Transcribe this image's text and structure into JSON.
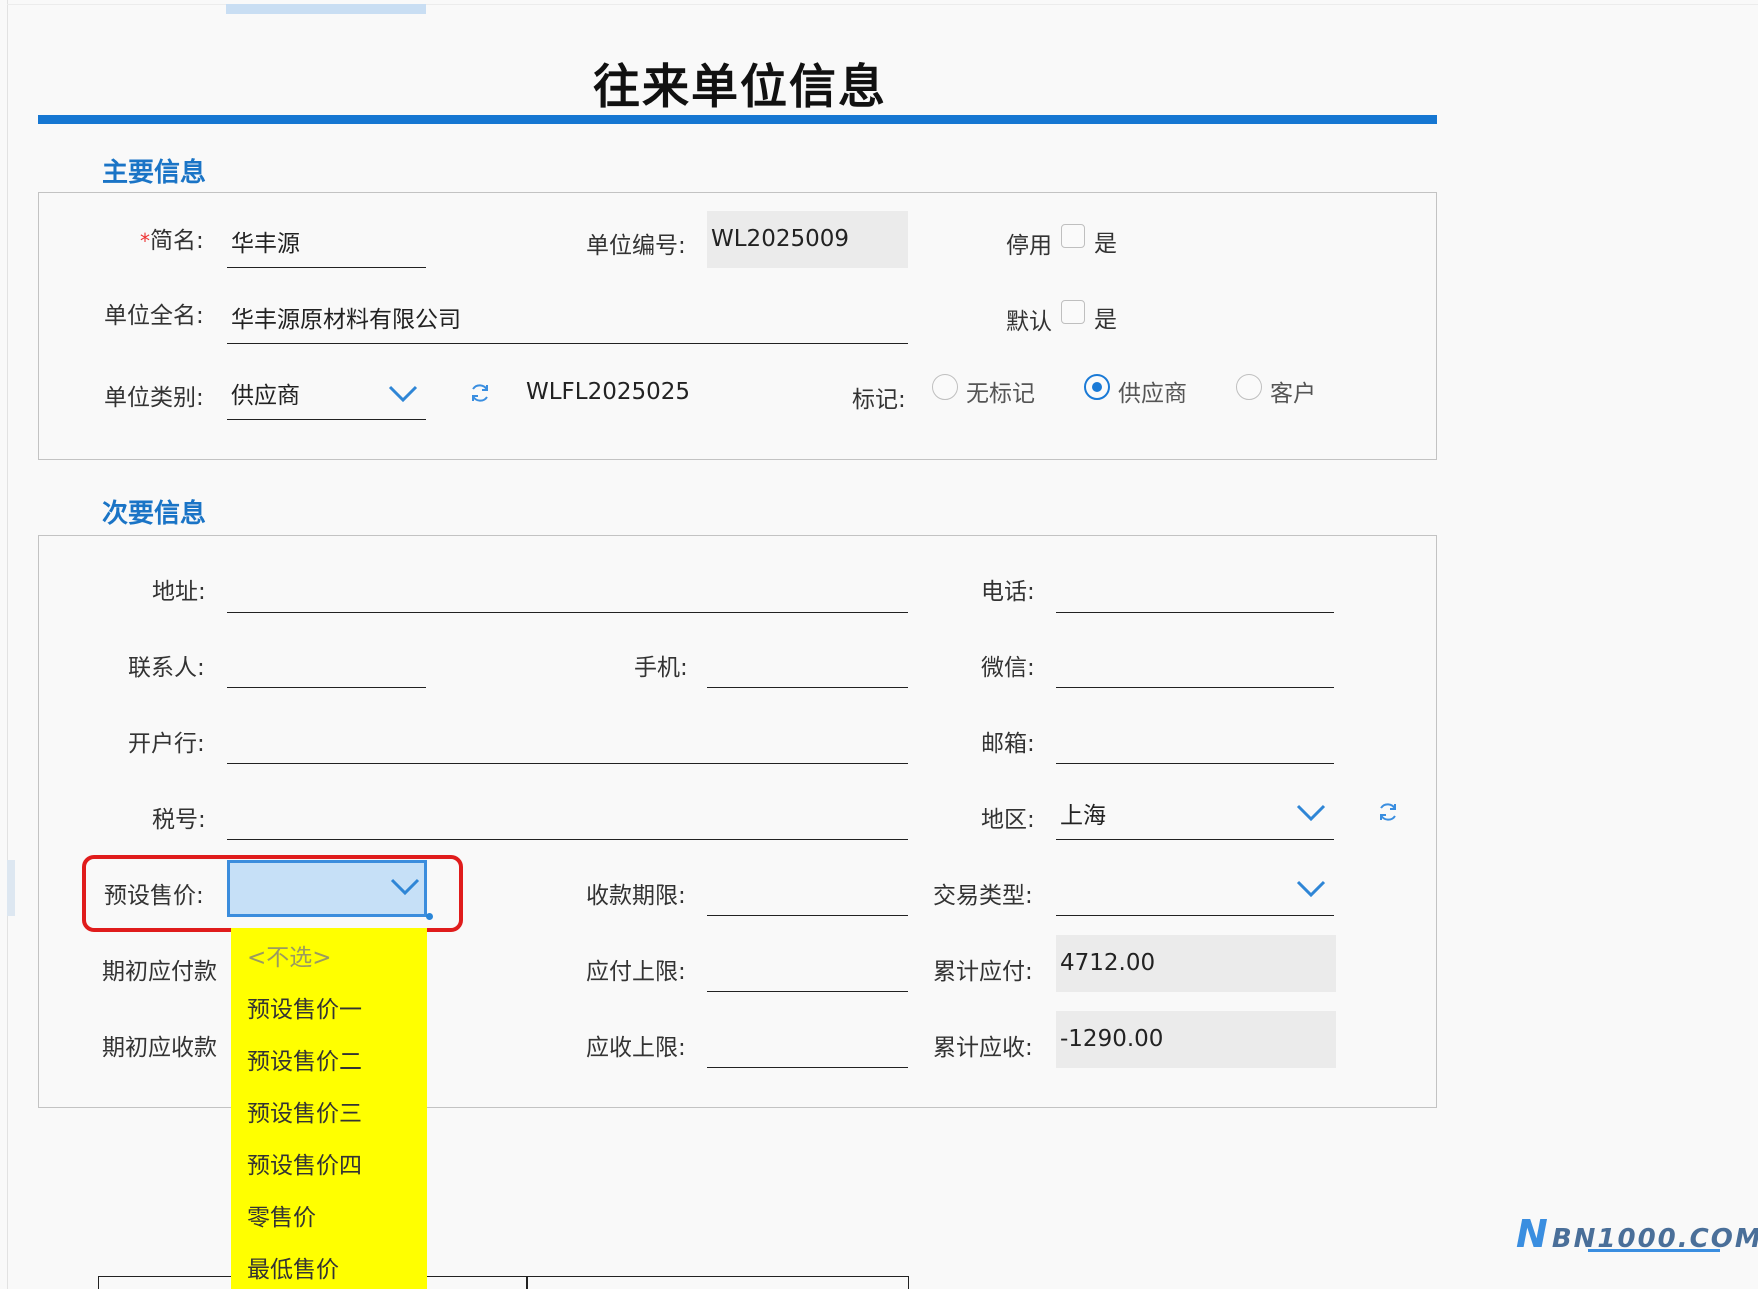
{
  "title": "往来单位信息",
  "primary": {
    "section_title": "主要信息",
    "short_name": {
      "required_mark": "*",
      "label": "简名:",
      "value": "华丰源"
    },
    "code": {
      "label": "单位编号:",
      "value": "WL2025009"
    },
    "disabled": {
      "label": "停用",
      "option": "是",
      "checked": false
    },
    "full_name": {
      "label": "单位全名:",
      "value": "华丰源原材料有限公司"
    },
    "default": {
      "label": "默认",
      "option": "是",
      "checked": false
    },
    "category": {
      "label": "单位类别:",
      "value": "供应商",
      "code": "WLFL2025025"
    },
    "mark": {
      "label": "标记:",
      "options": [
        "无标记",
        "供应商",
        "客户"
      ],
      "selected": "供应商"
    }
  },
  "secondary": {
    "section_title": "次要信息",
    "address": {
      "label": "地址:",
      "value": ""
    },
    "phone": {
      "label": "电话:",
      "value": ""
    },
    "contact": {
      "label": "联系人:",
      "value": ""
    },
    "mobile": {
      "label": "手机:",
      "value": ""
    },
    "wechat": {
      "label": "微信:",
      "value": ""
    },
    "bank": {
      "label": "开户行:",
      "value": ""
    },
    "email": {
      "label": "邮箱:",
      "value": ""
    },
    "tax_no": {
      "label": "税号:",
      "value": ""
    },
    "region": {
      "label": "地区:",
      "value": "上海"
    },
    "preset_price": {
      "label": "预设售价:",
      "value": ""
    },
    "payment_term": {
      "label": "收款期限:",
      "value": ""
    },
    "trade_type": {
      "label": "交易类型:",
      "value": ""
    },
    "initial_payable": {
      "label": "期初应付款",
      "value": ""
    },
    "payable_limit": {
      "label": "应付上限:",
      "value": ""
    },
    "total_payable": {
      "label": "累计应付:",
      "value": "4712.00"
    },
    "initial_receivable": {
      "label": "期初应收款",
      "value": ""
    },
    "receivable_limit": {
      "label": "应收上限:",
      "value": ""
    },
    "total_receivable": {
      "label": "累计应收:",
      "value": "-1290.00"
    }
  },
  "preset_price_dropdown": {
    "items": [
      "<不选>",
      "预设售价一",
      "预设售价二",
      "预设售价三",
      "预设售价四",
      "零售价",
      "最低售价"
    ]
  },
  "watermark": {
    "letter": "N",
    "text": "BN1000.COM"
  },
  "colors": {
    "accent": "#1677d2",
    "highlight": "#ffff00",
    "annotation": "#e01c1c"
  }
}
